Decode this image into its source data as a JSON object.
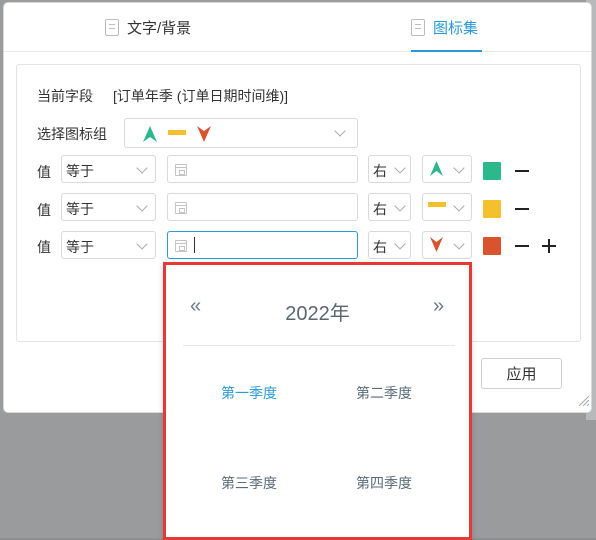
{
  "tabs": [
    {
      "label": "文字/背景"
    },
    {
      "label": "图标集"
    }
  ],
  "current_field": {
    "label": "当前字段",
    "value": "[订单年季 (订单日期时间维)]"
  },
  "icon_group": {
    "label": "选择图标组"
  },
  "rules": [
    {
      "label": "值",
      "operator": "等于",
      "position": "右",
      "icon": "up-arrow-icon",
      "color": "#2bb98b"
    },
    {
      "label": "值",
      "operator": "等于",
      "position": "右",
      "icon": "dash-icon",
      "color": "#f5c02e"
    },
    {
      "label": "值",
      "operator": "等于",
      "position": "右",
      "icon": "down-arrow-icon",
      "color": "#d9532f"
    }
  ],
  "apply_label": "应用",
  "picker": {
    "year": "2022年",
    "prev": "«",
    "next": "»",
    "quarters": [
      "第一季度",
      "第二季度",
      "第三季度",
      "第四季度"
    ]
  },
  "colors": {
    "accent": "#2a9ad6",
    "green": "#2bb98b",
    "yellow": "#f5c02e",
    "red": "#d9532f",
    "highlight": "#e53935"
  }
}
